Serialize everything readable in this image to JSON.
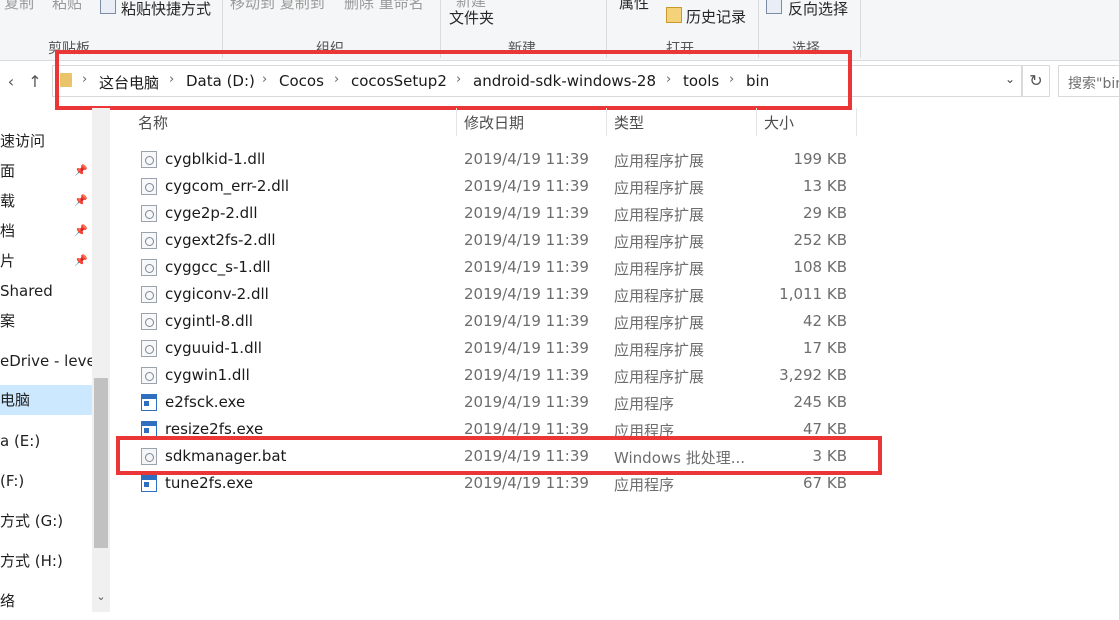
{
  "ribbon": {
    "copy_path": "复制",
    "paste": "粘贴",
    "paste_shortcut": "粘贴快捷方式",
    "move_copy": "移动到 复制到",
    "delete_rename": "删除 重命名",
    "new_folder_line1": "新建",
    "new_folder_line2": "文件夹",
    "properties": "属性",
    "history": "历史记录",
    "invert_selection": "反向选择",
    "groups": {
      "clipboard": "剪贴板",
      "organize": "组织",
      "new": "新建",
      "open": "打开",
      "select": "选择"
    }
  },
  "navigation": {
    "back_icon": "‹",
    "up_icon": "↑"
  },
  "address_bar": {
    "crumbs": [
      "这台电脑",
      "Data (D:)",
      "Cocos",
      "cocosSetup2",
      "android-sdk-windows-28",
      "tools",
      "bin"
    ],
    "separator": "›",
    "dropdown": "⌄",
    "refresh": "↻"
  },
  "search": {
    "placeholder": "搜索\"bin\""
  },
  "nav_pane": {
    "items": [
      {
        "label": "速访问",
        "pinned": false,
        "selected": false
      },
      {
        "label": "面",
        "pinned": true,
        "selected": false
      },
      {
        "label": "载",
        "pinned": true,
        "selected": false
      },
      {
        "label": "档",
        "pinned": true,
        "selected": false
      },
      {
        "label": "片",
        "pinned": true,
        "selected": false
      },
      {
        "label": "Shared",
        "pinned": false,
        "selected": false
      },
      {
        "label": "案",
        "pinned": false,
        "selected": false
      },
      {
        "label": "eDrive - lever",
        "pinned": false,
        "selected": false
      },
      {
        "label": "电脑",
        "pinned": false,
        "selected": true
      },
      {
        "label": "a (E:)",
        "pinned": false,
        "selected": false
      },
      {
        "label": "(F:)",
        "pinned": false,
        "selected": false
      },
      {
        "label": "方式 (G:)",
        "pinned": false,
        "selected": false
      },
      {
        "label": "方式 (H:)",
        "pinned": false,
        "selected": false
      },
      {
        "label": "络",
        "pinned": false,
        "selected": false
      }
    ],
    "pin_icon": "📌"
  },
  "columns": {
    "name": "名称",
    "date": "修改日期",
    "type": "类型",
    "size": "大小"
  },
  "files": [
    {
      "name": "cygblkid-1.dll",
      "date": "2019/4/19 11:39",
      "type": "应用程序扩展",
      "size": "199 KB",
      "icon": "dll-icon"
    },
    {
      "name": "cygcom_err-2.dll",
      "date": "2019/4/19 11:39",
      "type": "应用程序扩展",
      "size": "13 KB",
      "icon": "dll-icon"
    },
    {
      "name": "cyge2p-2.dll",
      "date": "2019/4/19 11:39",
      "type": "应用程序扩展",
      "size": "29 KB",
      "icon": "dll-icon"
    },
    {
      "name": "cygext2fs-2.dll",
      "date": "2019/4/19 11:39",
      "type": "应用程序扩展",
      "size": "252 KB",
      "icon": "dll-icon"
    },
    {
      "name": "cyggcc_s-1.dll",
      "date": "2019/4/19 11:39",
      "type": "应用程序扩展",
      "size": "108 KB",
      "icon": "dll-icon"
    },
    {
      "name": "cygiconv-2.dll",
      "date": "2019/4/19 11:39",
      "type": "应用程序扩展",
      "size": "1,011 KB",
      "icon": "dll-icon"
    },
    {
      "name": "cygintl-8.dll",
      "date": "2019/4/19 11:39",
      "type": "应用程序扩展",
      "size": "42 KB",
      "icon": "dll-icon"
    },
    {
      "name": "cyguuid-1.dll",
      "date": "2019/4/19 11:39",
      "type": "应用程序扩展",
      "size": "17 KB",
      "icon": "dll-icon"
    },
    {
      "name": "cygwin1.dll",
      "date": "2019/4/19 11:39",
      "type": "应用程序扩展",
      "size": "3,292 KB",
      "icon": "dll-icon"
    },
    {
      "name": "e2fsck.exe",
      "date": "2019/4/19 11:39",
      "type": "应用程序",
      "size": "245 KB",
      "icon": "exe-icon"
    },
    {
      "name": "resize2fs.exe",
      "date": "2019/4/19 11:39",
      "type": "应用程序",
      "size": "47 KB",
      "icon": "exe-icon"
    },
    {
      "name": "sdkmanager.bat",
      "date": "2019/4/19 11:39",
      "type": "Windows 批处理...",
      "size": "3 KB",
      "icon": "bat-icon"
    },
    {
      "name": "tune2fs.exe",
      "date": "2019/4/19 11:39",
      "type": "应用程序",
      "size": "67 KB",
      "icon": "exe-icon"
    }
  ],
  "colors": {
    "highlight_box": "#ea3636",
    "selection": "#cce8ff"
  }
}
